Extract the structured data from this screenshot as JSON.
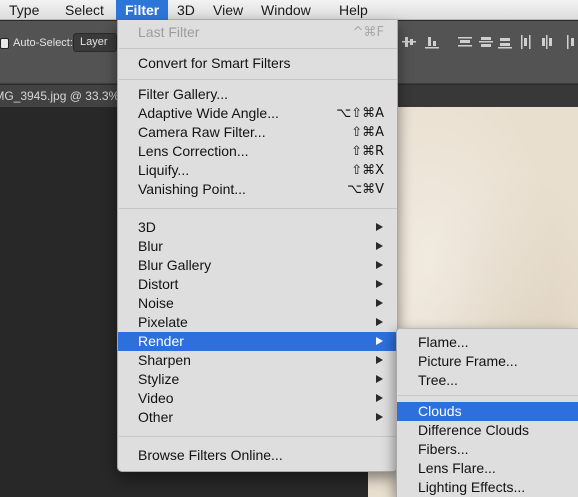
{
  "menubar": {
    "items": [
      {
        "label": "Type"
      },
      {
        "label": "Select"
      },
      {
        "label": "Filter",
        "active": true
      },
      {
        "label": "3D"
      },
      {
        "label": "View"
      },
      {
        "label": "Window"
      },
      {
        "label": "Help"
      }
    ]
  },
  "options_bar": {
    "auto_select_label": "Auto-Select:",
    "auto_select_value": "Layer"
  },
  "document": {
    "tab_title": "IMG_3945.jpg @ 33.3%"
  },
  "filter_menu": {
    "last_filter": {
      "label": "Last Filter",
      "shortcut": "^⌘F"
    },
    "convert": {
      "label": "Convert for Smart Filters"
    },
    "gallery": [
      {
        "label": "Filter Gallery...",
        "shortcut": ""
      },
      {
        "label": "Adaptive Wide Angle...",
        "shortcut": "⌥⇧⌘A"
      },
      {
        "label": "Camera Raw Filter...",
        "shortcut": "⇧⌘A"
      },
      {
        "label": "Lens Correction...",
        "shortcut": "⇧⌘R"
      },
      {
        "label": "Liquify...",
        "shortcut": "⇧⌘X"
      },
      {
        "label": "Vanishing Point...",
        "shortcut": "⌥⌘V"
      }
    ],
    "submenus": [
      {
        "label": "3D"
      },
      {
        "label": "Blur"
      },
      {
        "label": "Blur Gallery"
      },
      {
        "label": "Distort"
      },
      {
        "label": "Noise"
      },
      {
        "label": "Pixelate"
      },
      {
        "label": "Render",
        "highlighted": true
      },
      {
        "label": "Sharpen"
      },
      {
        "label": "Stylize"
      },
      {
        "label": "Video"
      },
      {
        "label": "Other"
      }
    ],
    "browse": {
      "label": "Browse Filters Online..."
    }
  },
  "render_submenu": {
    "group1": [
      {
        "label": "Flame..."
      },
      {
        "label": "Picture Frame..."
      },
      {
        "label": "Tree..."
      }
    ],
    "group2": [
      {
        "label": "Clouds",
        "highlighted": true
      },
      {
        "label": "Difference Clouds"
      },
      {
        "label": "Fibers..."
      },
      {
        "label": "Lens Flare..."
      },
      {
        "label": "Lighting Effects..."
      }
    ]
  },
  "colors": {
    "menu_highlight": "#2d6fdc",
    "menu_background": "#dedede",
    "options_bar": "#535353",
    "workspace": "#282828",
    "canvas_paper": "#e9dfcf"
  }
}
